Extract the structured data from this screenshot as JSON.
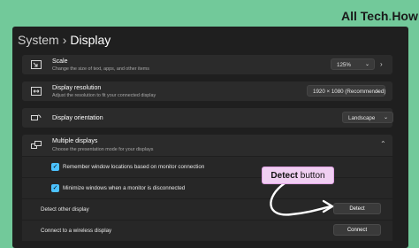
{
  "brand": {
    "name_part1": "All Tech",
    "name_dot": ".",
    "name_part2": "How"
  },
  "breadcrumb": {
    "parent": "System",
    "separator": "›",
    "current": "Display"
  },
  "scale": {
    "title": "Scale",
    "subtitle": "Change the size of text, apps, and other items",
    "value": "125%",
    "icon": "zoom-icon"
  },
  "resolution": {
    "title": "Display resolution",
    "subtitle": "Adjust the resolution to fit your connected display",
    "value": "1920 × 1080 (Recommended)",
    "icon": "resolution-icon"
  },
  "orientation": {
    "title": "Display orientation",
    "value": "Landscape",
    "icon": "orientation-icon"
  },
  "multiple": {
    "title": "Multiple displays",
    "subtitle": "Choose the presentation mode for your displays",
    "icon": "multiple-displays-icon",
    "remember_label": "Remember window locations based on monitor connection",
    "remember_checked": true,
    "minimize_label": "Minimize windows when a monitor is disconnected",
    "minimize_checked": true,
    "detect_label": "Detect other display",
    "detect_button": "Detect",
    "connect_label": "Connect to a wireless display",
    "connect_button": "Connect"
  },
  "callout": {
    "bold": "Detect",
    "rest": " button"
  },
  "colors": {
    "accent": "#4cc2ff",
    "callout_bg": "#f0cff2",
    "page_bg": "#72c99a"
  }
}
